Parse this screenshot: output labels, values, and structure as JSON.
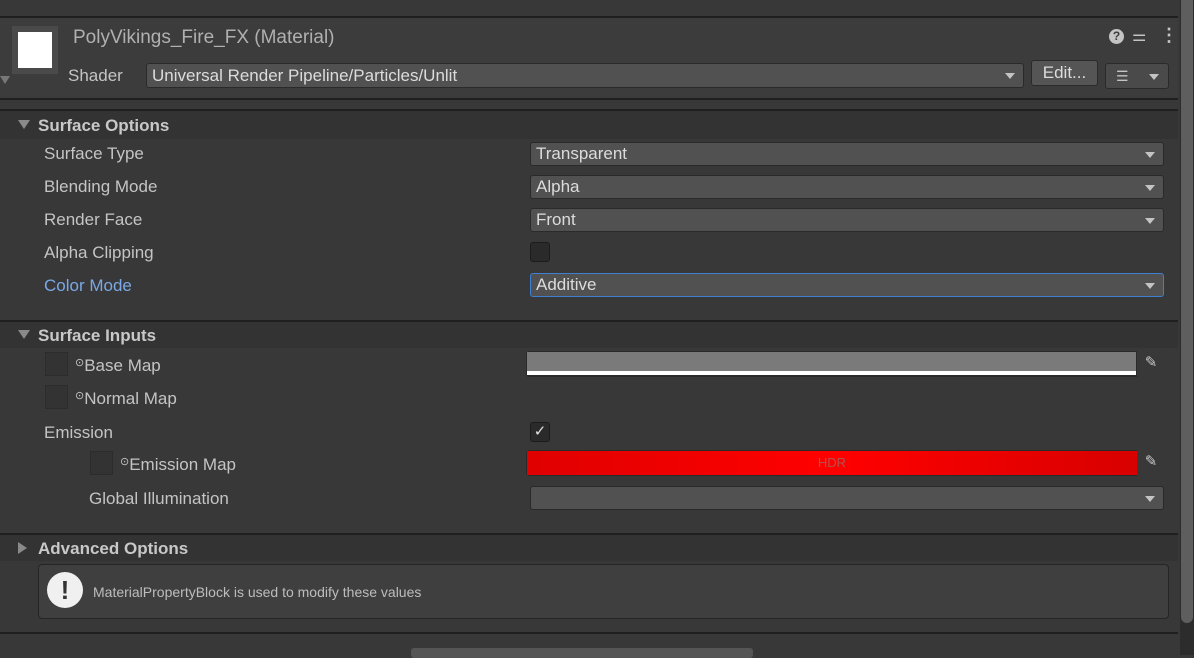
{
  "header": {
    "title": "PolyVikings_Fire_FX (Material)",
    "shader_label": "Shader",
    "shader_value": "Universal Render Pipeline/Particles/Unlit",
    "edit_label": "Edit..."
  },
  "surface_options": {
    "title": "Surface Options",
    "rows": [
      {
        "label": "Surface Type",
        "value": "Transparent"
      },
      {
        "label": "Blending Mode",
        "value": "Alpha"
      },
      {
        "label": "Render Face",
        "value": "Front"
      },
      {
        "label": "Alpha Clipping",
        "checked": false
      },
      {
        "label": "Color Mode",
        "value": "Additive"
      }
    ]
  },
  "surface_inputs": {
    "title": "Surface Inputs",
    "base_map": "Base Map",
    "normal_map": "Normal Map",
    "emission": "Emission",
    "emission_checked": true,
    "emission_map": "Emission Map",
    "hdr": "HDR",
    "global_illumination": "Global Illumination",
    "global_illumination_value": ""
  },
  "advanced": {
    "title": "Advanced Options"
  },
  "help": {
    "message": "MaterialPropertyBlock is used to modify these values"
  },
  "colors": {
    "accent": "#7aa8e6",
    "emission": "#ff0000"
  }
}
